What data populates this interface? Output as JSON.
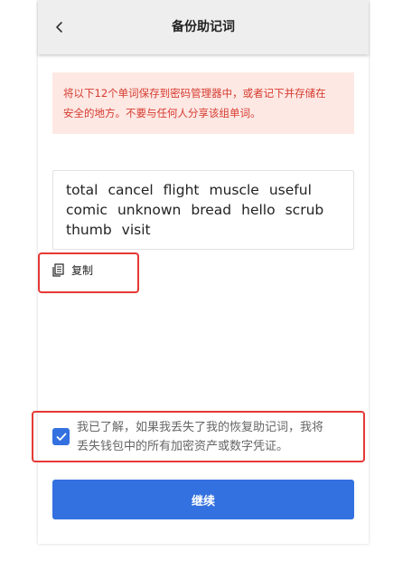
{
  "header": {
    "title": "备份助记词",
    "back_icon": "chevron-left-icon"
  },
  "warning": {
    "line1": "将以下12个单词保存到密码管理器中，或者记下并存储在",
    "line2": "安全的地方。不要与任何人分享该组单词。"
  },
  "mnemonic": {
    "words": [
      "total",
      "cancel",
      "flight",
      "muscle",
      "useful",
      "comic",
      "unknown",
      "bread",
      "hello",
      "scrub",
      "thumb",
      "visit"
    ]
  },
  "copy": {
    "label": "复制",
    "icon": "document-copy-icon"
  },
  "consent": {
    "checked": true,
    "line1": "我已了解，如果我丢失了我的恢复助记词，我将",
    "line2": "丢失钱包中的所有加密资产或数字凭证。"
  },
  "continue_button": {
    "label": "继续"
  },
  "colors": {
    "accent": "#3370e0",
    "warning_bg": "#fde8e4",
    "warning_text": "#d63b2f",
    "highlight": "#e53935"
  }
}
